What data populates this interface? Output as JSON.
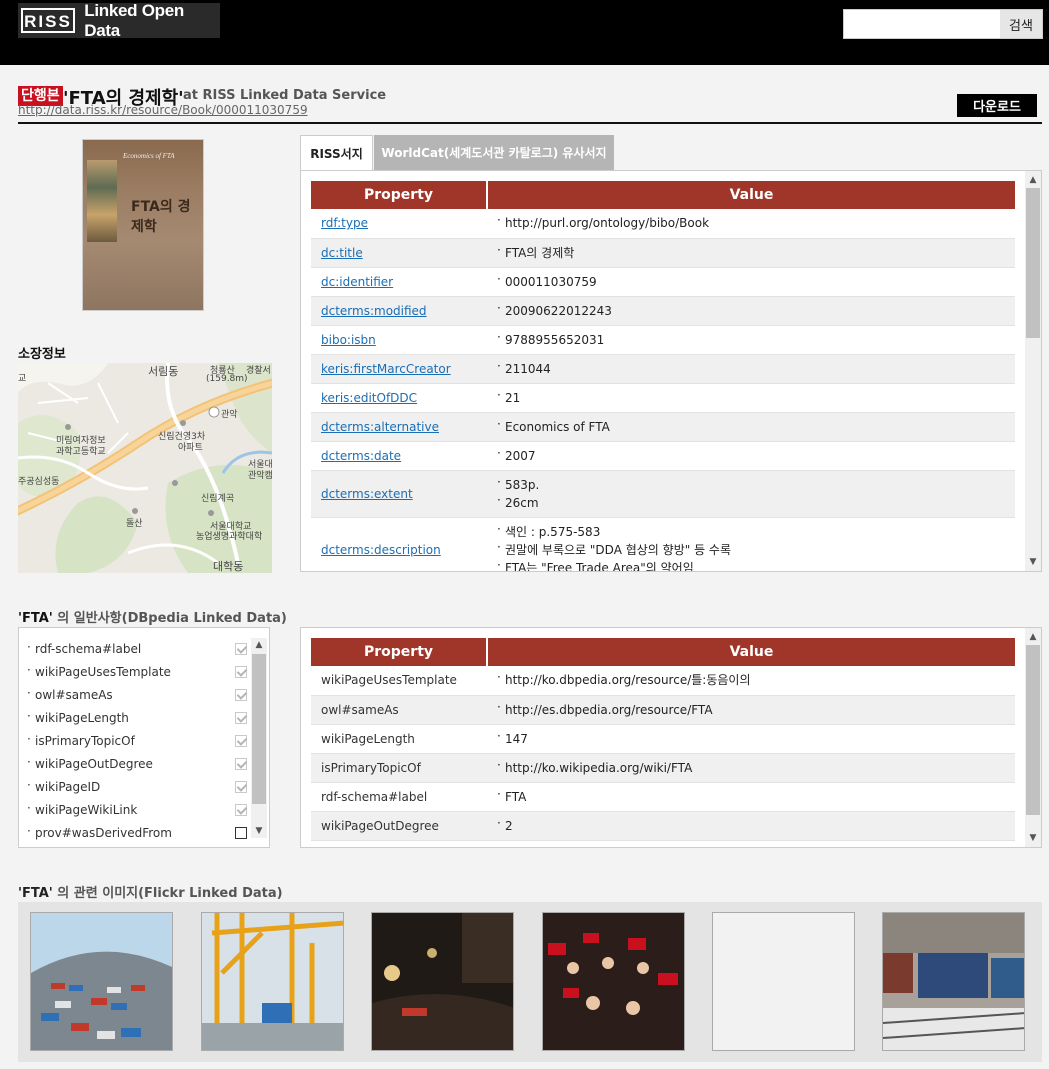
{
  "header": {
    "logo_mark": "RISS",
    "logo_text": "Linked Open Data",
    "search_placeholder": "",
    "search_button": "검색"
  },
  "resource": {
    "type_badge": "단행본",
    "title": "'FTA의 경제학'",
    "at_text": "at RISS Linked Data Service",
    "uri": "http://data.riss.kr/resource/Book/000011030759",
    "download_label": "다운로드"
  },
  "cover": {
    "top_text": "Economics of FTA",
    "title": "FTA의 경제학"
  },
  "holding": {
    "title": "소장정보",
    "map_labels": [
      "서림동",
      "청룡산",
      "(159.8m)",
      "경찰서",
      "관악",
      "미림여자정보",
      "과학고등학교",
      "신림건영3차",
      "아파트",
      "서울대",
      "관악캠",
      "주공심성동",
      "신림계곡",
      "돌산",
      "서울대학교",
      "농업생명과학대학",
      "대학동",
      "교"
    ]
  },
  "tabs": [
    {
      "label": "RISS서지",
      "active": true
    },
    {
      "label": "WorldCat(세계도서관 카탈로그) 유사서지",
      "active": false
    }
  ],
  "riss_table": {
    "headers": [
      "Property",
      "Value"
    ],
    "rows": [
      {
        "property": "rdf:type",
        "values": [
          "http://purl.org/ontology/bibo/Book"
        ]
      },
      {
        "property": "dc:title",
        "values": [
          "FTA의 경제학"
        ]
      },
      {
        "property": "dc:identifier",
        "values": [
          "000011030759"
        ]
      },
      {
        "property": "dcterms:modified",
        "values": [
          "20090622012243"
        ]
      },
      {
        "property": "bibo:isbn",
        "values": [
          "9788955652031"
        ]
      },
      {
        "property": "keris:firstMarcCreator",
        "values": [
          "211044"
        ]
      },
      {
        "property": "keris:editOfDDC",
        "values": [
          "21"
        ]
      },
      {
        "property": "dcterms:alternative",
        "values": [
          "Economics of FTA"
        ]
      },
      {
        "property": "dcterms:date",
        "values": [
          "2007"
        ]
      },
      {
        "property": "dcterms:extent",
        "values": [
          "583p.",
          "26cm"
        ]
      },
      {
        "property": "dcterms:description",
        "values": [
          "색인 : p.575-583",
          "권말에 부록으로 \"DDA 협상의 향방\" 등 수록",
          "FTA는 \"Free Trade Area\"의 약어임"
        ]
      }
    ]
  },
  "dbpedia": {
    "title_quote": "'FTA'",
    "title_rest": "의 일반사항(DBpedia Linked Data)",
    "filters": [
      {
        "label": "rdf-schema#label",
        "checked": true
      },
      {
        "label": "wikiPageUsesTemplate",
        "checked": true
      },
      {
        "label": "owl#sameAs",
        "checked": true
      },
      {
        "label": "wikiPageLength",
        "checked": true
      },
      {
        "label": "isPrimaryTopicOf",
        "checked": true
      },
      {
        "label": "wikiPageOutDegree",
        "checked": true
      },
      {
        "label": "wikiPageID",
        "checked": true
      },
      {
        "label": "wikiPageWikiLink",
        "checked": true
      },
      {
        "label": "prov#wasDerivedFrom",
        "checked": false
      }
    ],
    "table": {
      "headers": [
        "Property",
        "Value"
      ],
      "rows": [
        {
          "property": "wikiPageUsesTemplate",
          "values": [
            "http://ko.dbpedia.org/resource/틀:동음이의"
          ]
        },
        {
          "property": "owl#sameAs",
          "values": [
            "http://es.dbpedia.org/resource/FTA"
          ]
        },
        {
          "property": "wikiPageLength",
          "values": [
            "147"
          ]
        },
        {
          "property": "isPrimaryTopicOf",
          "values": [
            "http://ko.wikipedia.org/wiki/FTA"
          ]
        },
        {
          "property": "rdf-schema#label",
          "values": [
            "FTA"
          ]
        },
        {
          "property": "wikiPageOutDegree",
          "values": [
            "2"
          ]
        }
      ]
    }
  },
  "flickr": {
    "title_quote": "'FTA'",
    "title_rest": "의 관련 이미지(Flickr Linked Data)",
    "images": [
      "container-port-photo",
      "port-cranes-photo",
      "night-protest-photo",
      "candlelight-rally-photo",
      "blank-photo",
      "freight-train-photo"
    ]
  },
  "colors": {
    "header_bg": "#000000",
    "badge_red": "#c8101e",
    "table_header": "#a0352a",
    "link_blue": "#1a6eb5"
  }
}
